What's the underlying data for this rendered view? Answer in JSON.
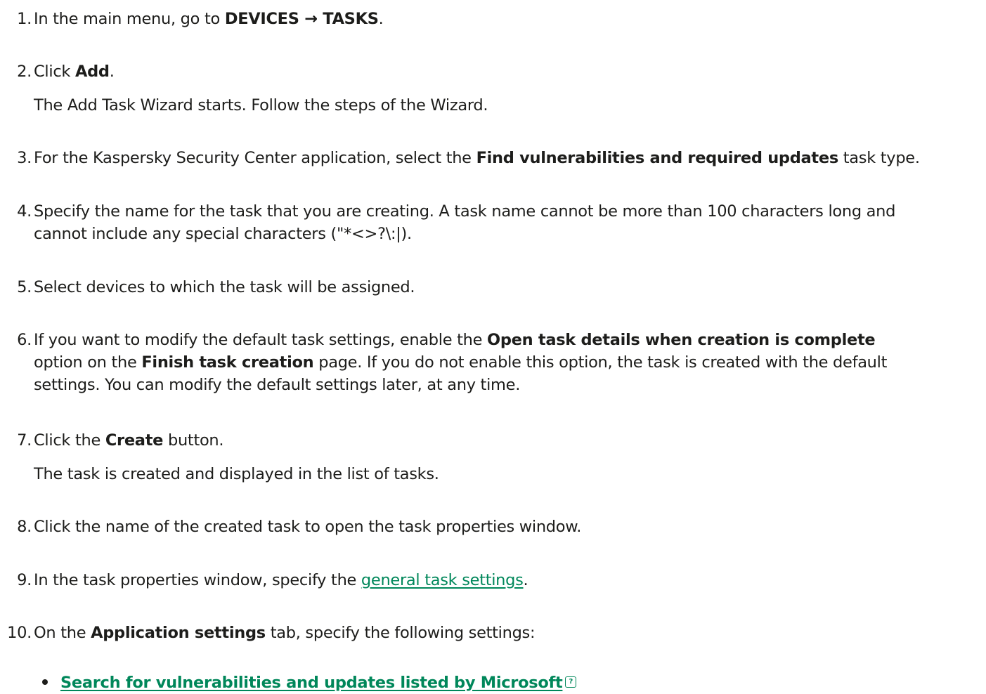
{
  "steps": [
    {
      "num": "1.",
      "parts": [
        "In the main menu, go to ",
        "DEVICES → TASKS",
        "."
      ]
    },
    {
      "num": "2.",
      "parts": [
        "Click ",
        "Add",
        "."
      ],
      "note": "The Add Task Wizard starts. Follow the steps of the Wizard."
    },
    {
      "num": "3.",
      "parts": [
        "For the Kaspersky Security Center application, select the ",
        "Find vulnerabilities and required updates",
        " task type."
      ]
    },
    {
      "num": "4.",
      "line1": "Specify the name for the task that you are creating. A task name cannot be more than 100 characters long and",
      "line2": "cannot include any special characters (\"*<>?\\:|)."
    },
    {
      "num": "5.",
      "text": "Select devices to which the task will be assigned."
    },
    {
      "num": "6.",
      "line1_parts": [
        "If you want to modify the default task settings, enable the ",
        "Open task details when creation is complete"
      ],
      "line2_parts": [
        "option on the ",
        "Finish task creation",
        " page. If you do not enable this option, the task is created with the default"
      ],
      "line3": "settings. You can modify the default settings later, at any time."
    },
    {
      "num": "7.",
      "parts": [
        "Click the ",
        "Create",
        " button."
      ],
      "note": "The task is created and displayed in the list of tasks."
    },
    {
      "num": "8.",
      "text": "Click the name of the created task to open the task properties window."
    },
    {
      "num": "9.",
      "parts": [
        "In the task properties window, specify the ",
        "general task settings",
        "."
      ]
    },
    {
      "num": "10.",
      "parts": [
        "On the ",
        "Application settings",
        " tab, specify the following settings:"
      ]
    }
  ],
  "bullets": [
    {
      "label": "Search for vulnerabilities and updates listed by Microsoft",
      "icon": "help-icon",
      "icon_glyph": "?"
    }
  ],
  "colors": {
    "text": "#1d1d1b",
    "link": "#00875a"
  }
}
